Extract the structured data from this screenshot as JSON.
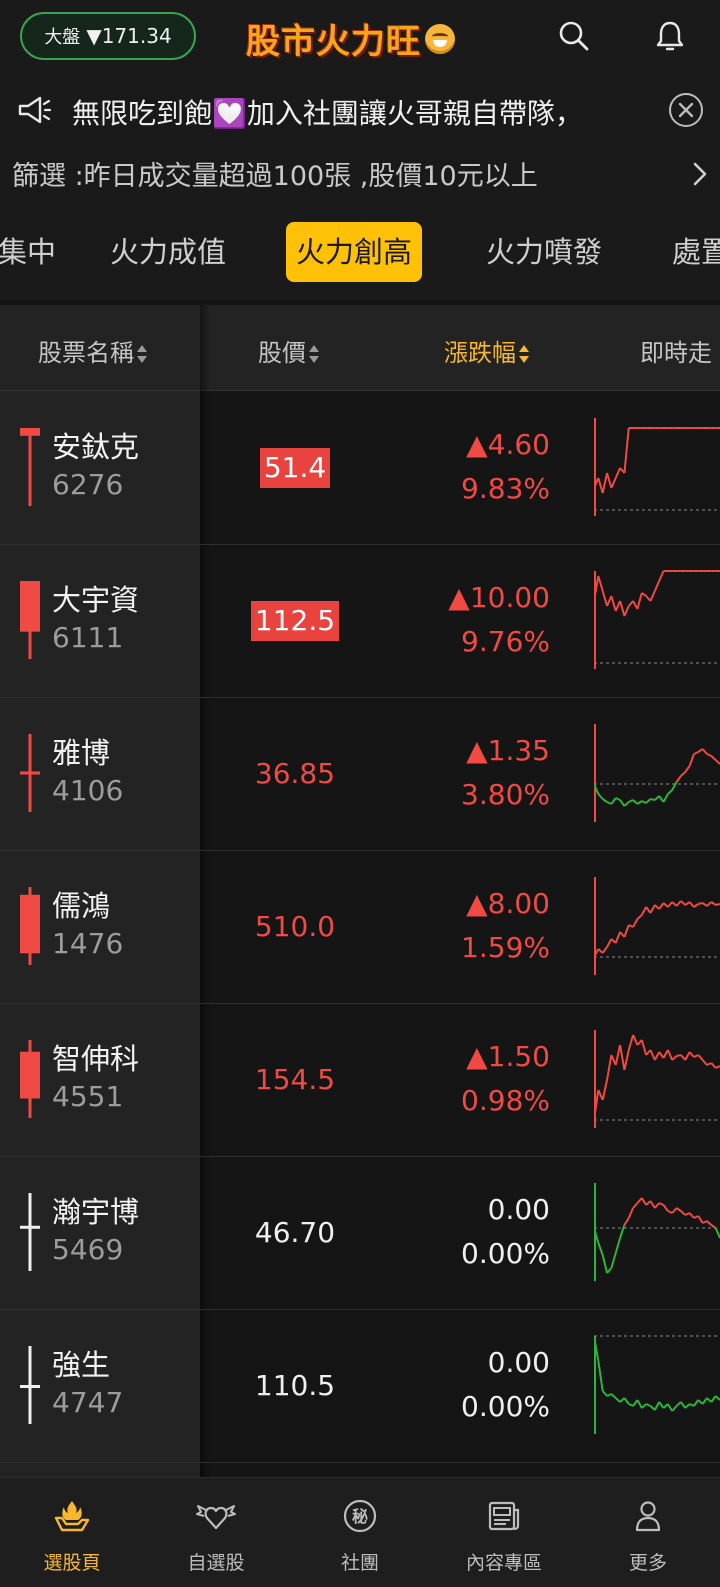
{
  "header": {
    "market_label": "大盤",
    "market_value": "▼171.34",
    "logo_text": "股市火力旺"
  },
  "announcement": {
    "text": "無限吃到飽💟加入社團讓火哥親自帶隊，"
  },
  "filter": {
    "text": "篩選 :昨日成交量超過100張 ,股價10元以上"
  },
  "tabs": [
    {
      "label": "集中",
      "active": false
    },
    {
      "label": "火力成值",
      "active": false
    },
    {
      "label": "火力創高",
      "active": true
    },
    {
      "label": "火力噴發",
      "active": false
    },
    {
      "label": "處置",
      "active": false
    }
  ],
  "table": {
    "columns": [
      "股票名稱",
      "股價",
      "漲跌幅",
      "即時走"
    ],
    "sorted_column": "漲跌幅",
    "rows": [
      {
        "name": "安鈦克",
        "code": "6276",
        "price": "51.4",
        "highlight": true,
        "change": "▲4.60",
        "percent": "9.83%",
        "trend": "up",
        "candle": {
          "open": 0.1,
          "close": 0.0,
          "high": 0.0,
          "low": 1.0
        },
        "spark": [
          0.7,
          0.6,
          0.75,
          0.55,
          0.7,
          0.6,
          0.5,
          0.55,
          0.1,
          0.1,
          0.1,
          0.1,
          0.1,
          0.1,
          0.1,
          0.1,
          0.1,
          0.1,
          0.1,
          0.1,
          0.1,
          0.1,
          0.1,
          0.1,
          0.1,
          0.1,
          0.1,
          0.1,
          0.1,
          0.1
        ]
      },
      {
        "name": "大宇資",
        "code": "6111",
        "price": "112.5",
        "highlight": true,
        "change": "▲10.00",
        "percent": "9.76%",
        "trend": "up",
        "candle": {
          "open": 0.65,
          "close": 0.0,
          "high": 0.0,
          "low": 1.0
        },
        "spark": [
          0.3,
          0.05,
          0.2,
          0.35,
          0.25,
          0.4,
          0.3,
          0.45,
          0.35,
          0.3,
          0.38,
          0.22,
          0.25,
          0.3,
          0.2,
          0.1,
          0.0,
          0.0,
          0.0,
          0.0,
          0.0,
          0.0,
          0.0,
          0.0,
          0.0,
          0.0,
          0.0,
          0.0,
          0.0,
          0.0
        ]
      },
      {
        "name": "雅博",
        "code": "4106",
        "price": "36.85",
        "highlight": false,
        "change": "▲1.35",
        "percent": "3.80%",
        "trend": "up",
        "candle": {
          "open": 0.52,
          "close": 0.48,
          "high": 0.0,
          "low": 1.0
        },
        "spark": [
          0.6,
          0.7,
          0.75,
          0.78,
          0.8,
          0.74,
          0.76,
          0.82,
          0.78,
          0.76,
          0.8,
          0.77,
          0.79,
          0.75,
          0.76,
          0.72,
          0.78,
          0.7,
          0.66,
          0.58,
          0.52,
          0.48,
          0.42,
          0.3,
          0.28,
          0.25,
          0.3,
          0.32,
          0.36,
          0.4
        ]
      },
      {
        "name": "儒鴻",
        "code": "1476",
        "price": "510.0",
        "highlight": false,
        "change": "▲8.00",
        "percent": "1.59%",
        "trend": "up",
        "candle": {
          "open": 0.85,
          "close": 0.1,
          "high": 0.0,
          "low": 1.0
        },
        "spark": [
          0.8,
          0.72,
          0.76,
          0.7,
          0.62,
          0.66,
          0.55,
          0.6,
          0.48,
          0.5,
          0.42,
          0.38,
          0.3,
          0.36,
          0.28,
          0.32,
          0.26,
          0.3,
          0.25,
          0.29,
          0.24,
          0.28,
          0.25,
          0.3,
          0.27,
          0.26,
          0.29,
          0.25,
          0.28,
          0.27
        ]
      },
      {
        "name": "智伸科",
        "code": "4551",
        "price": "154.5",
        "highlight": false,
        "change": "▲1.50",
        "percent": "0.98%",
        "trend": "up",
        "candle": {
          "open": 0.75,
          "close": 0.15,
          "high": 0.0,
          "low": 1.0
        },
        "spark": [
          0.9,
          0.6,
          0.7,
          0.5,
          0.25,
          0.35,
          0.15,
          0.4,
          0.2,
          0.05,
          0.15,
          0.1,
          0.25,
          0.2,
          0.3,
          0.22,
          0.28,
          0.2,
          0.3,
          0.26,
          0.25,
          0.3,
          0.22,
          0.27,
          0.25,
          0.3,
          0.35,
          0.33,
          0.38,
          0.36
        ]
      },
      {
        "name": "瀚宇博",
        "code": "5469",
        "price": "46.70",
        "highlight": false,
        "change": "0.00",
        "percent": "0.00%",
        "trend": "flat",
        "candle": {
          "open": 0.42,
          "close": 0.42,
          "high": 0.0,
          "low": 1.0
        },
        "spark": [
          0.45,
          0.6,
          0.72,
          0.9,
          0.85,
          0.7,
          0.55,
          0.42,
          0.35,
          0.25,
          0.2,
          0.15,
          0.22,
          0.18,
          0.25,
          0.2,
          0.22,
          0.28,
          0.3,
          0.25,
          0.28,
          0.32,
          0.3,
          0.35,
          0.33,
          0.4,
          0.38,
          0.42,
          0.45,
          0.55
        ]
      },
      {
        "name": "強生",
        "code": "4747",
        "price": "110.5",
        "highlight": false,
        "change": "0.00",
        "percent": "0.00%",
        "trend": "flat",
        "candle": {
          "open": 0.5,
          "close": 0.5,
          "high": 0.0,
          "low": 1.0
        },
        "spark": [
          0.0,
          0.25,
          0.55,
          0.6,
          0.58,
          0.62,
          0.66,
          0.62,
          0.68,
          0.7,
          0.64,
          0.72,
          0.68,
          0.7,
          0.74,
          0.66,
          0.72,
          0.68,
          0.75,
          0.7,
          0.66,
          0.72,
          0.68,
          0.7,
          0.64,
          0.68,
          0.62,
          0.66,
          0.6,
          0.64
        ]
      }
    ]
  },
  "bottom_nav": [
    {
      "label": "選股頁",
      "icon": "hand-flame-icon",
      "active": true
    },
    {
      "label": "自選股",
      "icon": "winged-heart-icon",
      "active": false
    },
    {
      "label": "社團",
      "icon": "secret-badge-icon",
      "active": false
    },
    {
      "label": "內容專區",
      "icon": "newspaper-icon",
      "active": false
    },
    {
      "label": "更多",
      "icon": "person-icon",
      "active": false
    }
  ],
  "colors": {
    "up": "#f04a45",
    "down": "#2fb33e",
    "flat": "#efefef",
    "accent": "#ffc107",
    "active_sort": "#f7b731"
  },
  "icons": {
    "search": "search-icon",
    "bell": "bell-icon",
    "speaker": "speaker-icon",
    "close": "close-icon",
    "chevron": "chevron-right-icon"
  }
}
